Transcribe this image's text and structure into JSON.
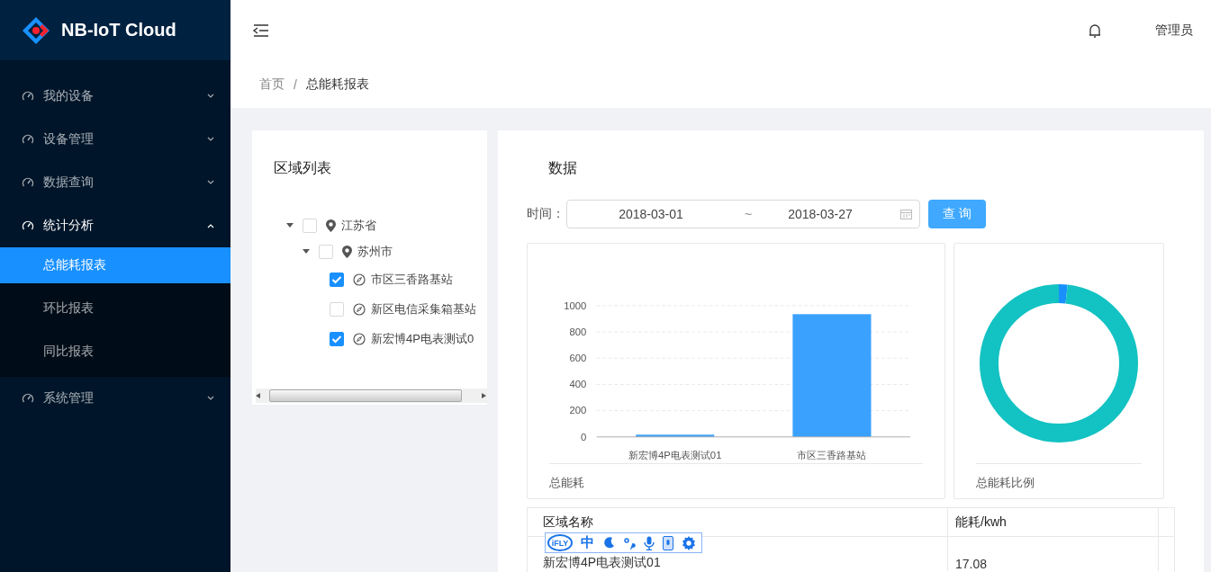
{
  "brand": {
    "name": "NB-IoT Cloud"
  },
  "menu": [
    {
      "label": "我的设备",
      "expanded": false
    },
    {
      "label": "设备管理",
      "expanded": false
    },
    {
      "label": "数据查询",
      "expanded": false
    },
    {
      "label": "统计分析",
      "expanded": true,
      "children": [
        {
          "label": "总能耗报表",
          "selected": true
        },
        {
          "label": "环比报表",
          "selected": false
        },
        {
          "label": "同比报表",
          "selected": false
        }
      ]
    },
    {
      "label": "系统管理",
      "expanded": false
    }
  ],
  "header": {
    "user": "管理员"
  },
  "breadcrumb": [
    "首页",
    "/",
    "总能耗报表"
  ],
  "region_panel": {
    "title": "区域列表",
    "tree": [
      {
        "label": "江苏省",
        "kind": "region",
        "checked": false,
        "expanded": true,
        "children": [
          {
            "label": "苏州市",
            "kind": "region",
            "checked": false,
            "expanded": true,
            "children": [
              {
                "label": "市区三香路基站",
                "kind": "station",
                "checked": true
              },
              {
                "label": "新区电信采集箱基站",
                "kind": "station",
                "checked": false
              },
              {
                "label": "新宏博4P电表测试0",
                "kind": "station",
                "checked": true
              }
            ]
          }
        ]
      }
    ]
  },
  "data_panel": {
    "title": "数据",
    "time_label": "时间：",
    "start_date": "2018-03-01",
    "separator": "~",
    "end_date": "2018-03-27",
    "query_button": "查 询",
    "bar_card": {
      "caption": "总能耗",
      "chart_data": {
        "type": "bar",
        "categories": [
          "新宏博4P电表测试01",
          "市区三香路基站"
        ],
        "series": [
          {
            "color": "#3aa1ff",
            "values": [
              17,
              935
            ]
          }
        ],
        "grid": true,
        "ylim": [
          0,
          1000
        ],
        "yticks": [
          0,
          200,
          400,
          600,
          800,
          1000
        ]
      }
    },
    "donut_card": {
      "caption": "总能耗比例"
    },
    "table": {
      "columns": [
        "区域名称",
        "能耗/kwh"
      ],
      "rows": [
        [
          "新宏博4P电表测试01",
          "17.08"
        ]
      ]
    }
  },
  "ime_toolbar": {
    "logo": "iFLY",
    "mode": "中"
  }
}
